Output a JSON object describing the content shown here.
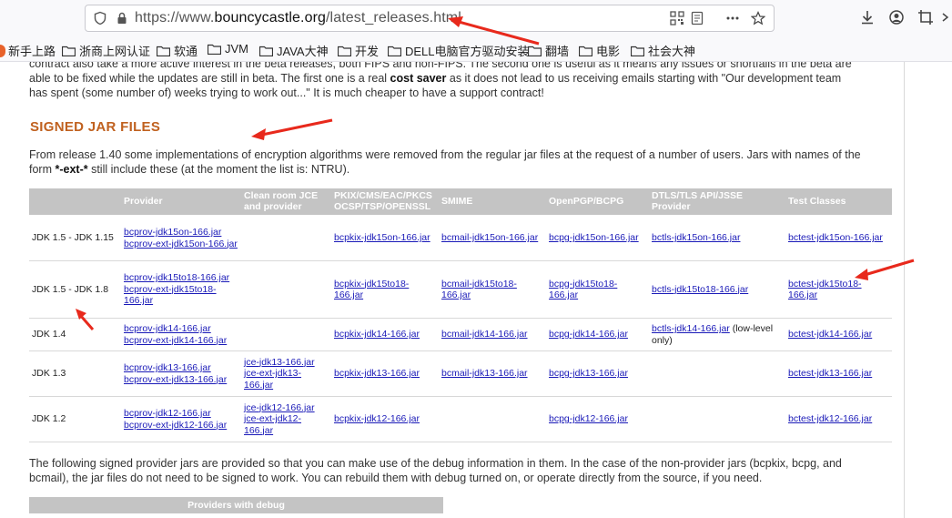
{
  "browser": {
    "url_prefix": "https://www.",
    "url_domain": "bouncycastle.org",
    "url_path": "/latest_releases.html",
    "bookmarks": [
      {
        "label": "新手上路",
        "icon": "firefox-icon"
      },
      {
        "label": "浙商上网认证",
        "icon": "folder-icon"
      },
      {
        "label": "软通",
        "icon": "folder-icon"
      },
      {
        "label": "JVM",
        "icon": "folder-icon"
      },
      {
        "label": "JAVA大神",
        "icon": "folder-icon"
      },
      {
        "label": "开发",
        "icon": "folder-icon"
      },
      {
        "label": "DELL电脑官方驱动安装",
        "icon": "folder-icon"
      },
      {
        "label": "翻墙",
        "icon": "folder-icon"
      },
      {
        "label": "电影",
        "icon": "folder-icon"
      },
      {
        "label": "社会大神",
        "icon": "folder-icon"
      }
    ],
    "accent_arrow_color": "#e8291c"
  },
  "page": {
    "intro_line1": "contract also take a more active interest in the beta releases, both FIPS and non-FIPS. The second one is useful as it means any issues or shortfalls in the beta are",
    "intro_line2": "able to be fixed while the updates are still in beta. The first one is a real ",
    "intro_bold": "cost saver",
    "intro_line2b": " as it does not lead to us receiving emails starting with \"Our development team",
    "intro_line3": "has spent (some number of) weeks trying to work out...\" It is much cheaper to have a support contract!",
    "section_title": "SIGNED JAR FILES",
    "desc_line1": "From release 1.40 some implementations of encryption algorithms were removed from the regular jar files at the request of a number of users. Jars with names of the",
    "desc_line2a": "form ",
    "desc_bold": "*-ext-*",
    "desc_line2b": " still include these (at the moment the list is: NTRU).",
    "table": {
      "headers": [
        "",
        "Provider",
        "Clean room JCE and provider",
        "PKIX/CMS/EAC/PKCS OCSP/TSP/OPENSSL",
        "SMIME",
        "OpenPGP/BCPG",
        "DTLS/TLS API/JSSE Provider",
        "Test Classes"
      ],
      "rows": [
        {
          "jdk": "JDK 1.5 - JDK 1.15",
          "provider": [
            "bcprov-jdk15on-166.jar",
            "bcprov-ext-jdk15on-166.jar"
          ],
          "jce": [],
          "pkix": [
            "bcpkix-jdk15on-166.jar"
          ],
          "smime": [
            "bcmail-jdk15on-166.jar"
          ],
          "pgp": [
            "bcpg-jdk15on-166.jar"
          ],
          "tls": [
            "bctls-jdk15on-166.jar"
          ],
          "tls_note": "",
          "test": [
            "bctest-jdk15on-166.jar"
          ]
        },
        {
          "jdk": "JDK 1.5 - JDK 1.8",
          "provider": [
            "bcprov-jdk15to18-166.jar",
            "bcprov-ext-jdk15to18-166.jar"
          ],
          "jce": [],
          "pkix": [
            "bcpkix-jdk15to18-166.jar"
          ],
          "smime": [
            "bcmail-jdk15to18-166.jar"
          ],
          "pgp": [
            "bcpg-jdk15to18-166.jar"
          ],
          "tls": [
            "bctls-jdk15to18-166.jar"
          ],
          "tls_note": "",
          "test": [
            "bctest-jdk15to18-166.jar"
          ]
        },
        {
          "jdk": "JDK 1.4",
          "provider": [
            "bcprov-jdk14-166.jar",
            "bcprov-ext-jdk14-166.jar"
          ],
          "jce": [],
          "pkix": [
            "bcpkix-jdk14-166.jar"
          ],
          "smime": [
            "bcmail-jdk14-166.jar"
          ],
          "pgp": [
            "bcpg-jdk14-166.jar"
          ],
          "tls": [
            "bctls-jdk14-166.jar"
          ],
          "tls_note": " (low-level only)",
          "test": [
            "bctest-jdk14-166.jar"
          ]
        },
        {
          "jdk": "JDK 1.3",
          "provider": [
            "bcprov-jdk13-166.jar",
            "bcprov-ext-jdk13-166.jar"
          ],
          "jce": [
            "jce-jdk13-166.jar",
            "jce-ext-jdk13-166.jar"
          ],
          "pkix": [
            "bcpkix-jdk13-166.jar"
          ],
          "smime": [
            "bcmail-jdk13-166.jar"
          ],
          "pgp": [
            "bcpg-jdk13-166.jar"
          ],
          "tls": [],
          "tls_note": "",
          "test": [
            "bctest-jdk13-166.jar"
          ]
        },
        {
          "jdk": "JDK 1.2",
          "provider": [
            "bcprov-jdk12-166.jar",
            "bcprov-ext-jdk12-166.jar"
          ],
          "jce": [
            "jce-jdk12-166.jar",
            "jce-ext-jdk12-166.jar"
          ],
          "pkix": [
            "bcpkix-jdk12-166.jar"
          ],
          "smime": [],
          "pgp": [
            "bcpg-jdk12-166.jar"
          ],
          "tls": [],
          "tls_note": "",
          "test": [
            "bctest-jdk12-166.jar"
          ]
        }
      ]
    },
    "footer_line1": "The following signed provider jars are provided so that you can make use of the debug information in them. In the case of the non-provider jars (bcpkix, bcpg, and",
    "footer_line2": "bcmail), the jar files do not need to be signed to work. You can rebuild them with debug turned on, or operate directly from the source, if you need.",
    "debug_header": "Providers with debug"
  }
}
